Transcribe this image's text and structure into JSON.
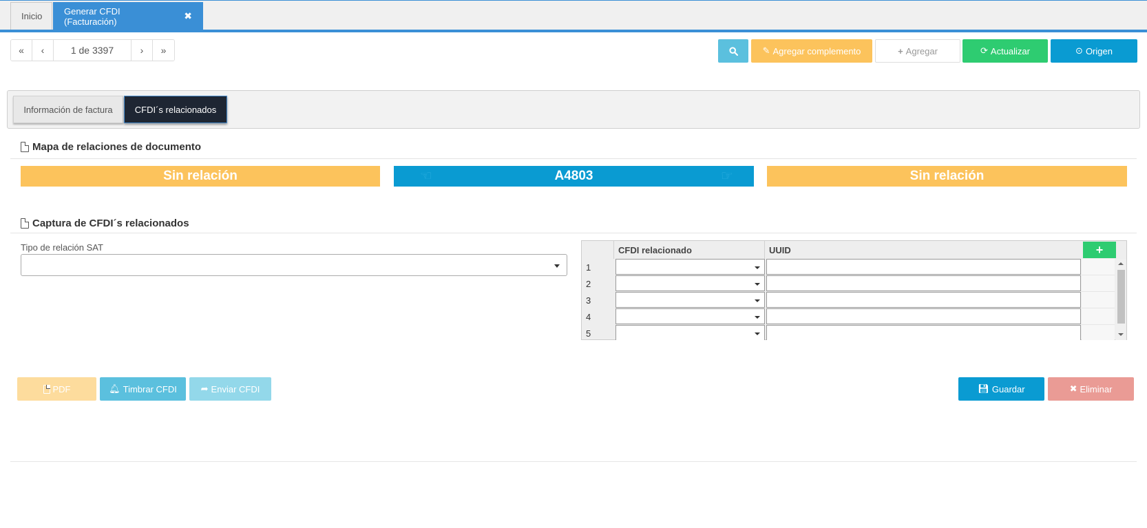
{
  "tabs": {
    "inicio": "Inicio",
    "active": "Generar CFDI (Facturación)",
    "close_glyph": "✖"
  },
  "pager": {
    "first": "«",
    "prev": "‹",
    "info": "1 de 3397",
    "next": "›",
    "last": "»"
  },
  "toolbar": {
    "search_glyph": "🔍",
    "agregar_complemento": "Agregar complemento",
    "agregar": "Agregar",
    "actualizar": "Actualizar",
    "origen": "Origen"
  },
  "inner_tabs": {
    "info": "Información de factura",
    "relacionados": "CFDI´s relacionados"
  },
  "mapa": {
    "title": "Mapa de relaciones de documento",
    "left": "Sin relación",
    "center": "A4803",
    "right": "Sin relación"
  },
  "captura": {
    "title": "Captura de CFDI´s relacionados",
    "tipo_label": "Tipo de relación SAT",
    "tipo_value": "",
    "columns": [
      "CFDI relacionado",
      "UUID"
    ],
    "add_glyph": "+",
    "rows": [
      {
        "num": "1",
        "cfdi": "",
        "uuid": ""
      },
      {
        "num": "2",
        "cfdi": "",
        "uuid": ""
      },
      {
        "num": "3",
        "cfdi": "",
        "uuid": ""
      },
      {
        "num": "4",
        "cfdi": "",
        "uuid": ""
      },
      {
        "num": "5",
        "cfdi": "",
        "uuid": ""
      }
    ]
  },
  "actions": {
    "pdf": "PDF",
    "timbrar": "Timbrar CFDI",
    "enviar": "Enviar CFDI",
    "guardar": "Guardar",
    "eliminar": "Eliminar"
  },
  "colors": {
    "primary": "#3a8fd6",
    "info": "#5bc0de",
    "warning": "#fcc35c",
    "success": "#2ecc71",
    "blue": "#0a9bd2",
    "danger_light": "#ea9b95"
  }
}
